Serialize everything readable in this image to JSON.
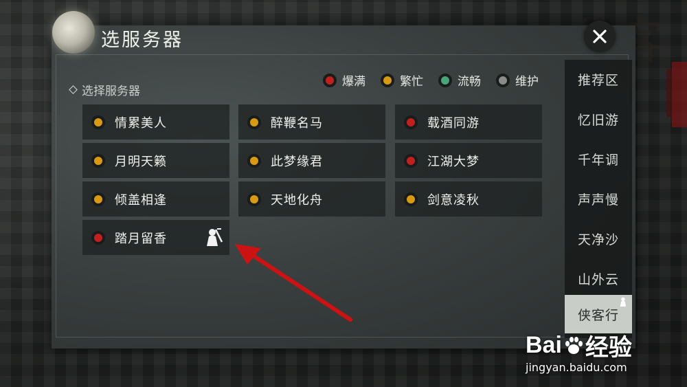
{
  "header": {
    "title": "选服务器"
  },
  "legend": [
    {
      "label": "爆满",
      "color": "#c0201e"
    },
    {
      "label": "繁忙",
      "color": "#d79a12"
    },
    {
      "label": "流畅",
      "color": "#49a47a"
    },
    {
      "label": "维护",
      "color": "#8a8c8a"
    }
  ],
  "section_label": "选择服务器",
  "servers": [
    {
      "name": "情累美人",
      "status": "繁忙",
      "color": "#d79a12"
    },
    {
      "name": "醉鞭名马",
      "status": "繁忙",
      "color": "#d79a12"
    },
    {
      "name": "载酒同游",
      "status": "爆满",
      "color": "#c0201e"
    },
    {
      "name": "月明天籁",
      "status": "繁忙",
      "color": "#d79a12"
    },
    {
      "name": "此梦缘君",
      "status": "繁忙",
      "color": "#d79a12"
    },
    {
      "name": "江湖大梦",
      "status": "爆满",
      "color": "#c0201e"
    },
    {
      "name": "倾盖相逢",
      "status": "繁忙",
      "color": "#d79a12"
    },
    {
      "name": "天地化舟",
      "status": "繁忙",
      "color": "#d79a12"
    },
    {
      "name": "剑意凌秋",
      "status": "繁忙",
      "color": "#d79a12"
    },
    {
      "name": "踏月留香",
      "status": "爆满",
      "color": "#c0201e",
      "badge": "character-badge-icon"
    }
  ],
  "regions": [
    {
      "label": "推荐区"
    },
    {
      "label": "忆旧游"
    },
    {
      "label": "千年调"
    },
    {
      "label": "声声慢"
    },
    {
      "label": "天净沙"
    },
    {
      "label": "山外云"
    },
    {
      "label": "侠客行",
      "active": true
    }
  ],
  "watermark": {
    "brand_left": "Bai",
    "brand_right": "经验",
    "url": "jingyan.baidu.com"
  },
  "icons": {
    "close": "close-icon",
    "moon": "moon-icon",
    "arrow": "red-arrow-annotation"
  }
}
